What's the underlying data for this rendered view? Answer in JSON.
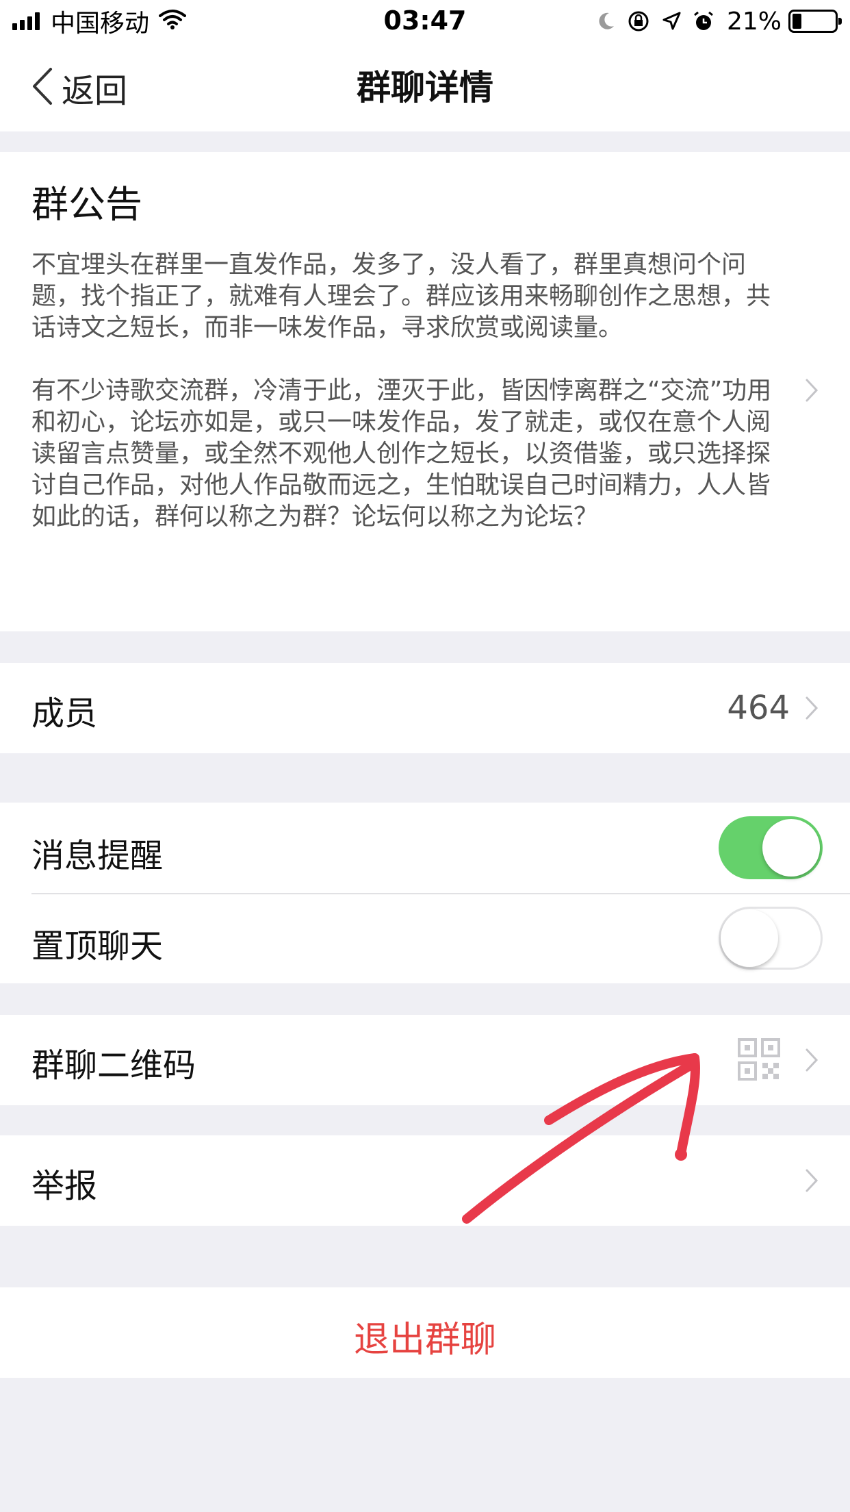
{
  "status_bar": {
    "carrier": "中国移动",
    "time": "03:47",
    "battery": "21%"
  },
  "nav": {
    "back_label": "返回",
    "title": "群聊详情"
  },
  "announcement": {
    "title": "群公告",
    "paragraph_1": "不宜埋头在群里一直发作品，发多了，没人看了，群里真想问个问题，找个指正了，就难有人理会了。群应该用来畅聊创作之思想，共话诗文之短长，而非一味发作品，寻求欣赏或阅读量。",
    "paragraph_2": "有不少诗歌交流群，冷清于此，湮灭于此，皆因悖离群之“交流”功用和初心，论坛亦如是，或只一味发作品，发了就走，或仅在意个人阅读留言点赞量，或全然不观他人创作之短长，以资借鉴，或只选择探讨自己作品，对他人作品敬而远之，生怕耽误自己时间精力，人人皆如此的话，群何以称之为群？论坛何以称之为论坛？"
  },
  "members": {
    "label": "成员",
    "count": "464"
  },
  "settings": {
    "notify_label": "消息提醒",
    "notify_on": true,
    "pin_label": "置顶聊天",
    "pin_on": false
  },
  "qrcode": {
    "label": "群聊二维码"
  },
  "report": {
    "label": "举报"
  },
  "exit": {
    "label": "退出群聊"
  },
  "colors": {
    "toggle_on": "#65d16b",
    "exit_text": "#e64340",
    "annotation_arrow": "#e8394a"
  }
}
